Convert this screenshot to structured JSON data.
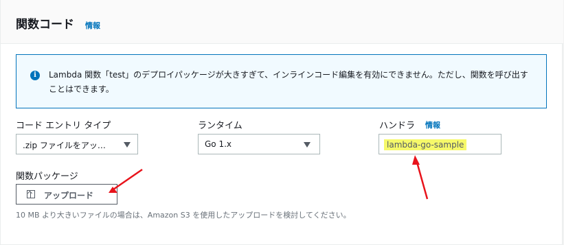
{
  "header": {
    "title": "関数コード",
    "info": "情報"
  },
  "alert": {
    "icon": "info-icon",
    "text": "Lambda 関数「test」のデプロイパッケージが大きすぎて、インラインコード編集を有効にできません。ただし、関数を呼び出すことはできます。"
  },
  "fields": {
    "entry_type": {
      "label": "コード エントリ タイプ",
      "value": ".zip ファイルをアッ…"
    },
    "runtime": {
      "label": "ランタイム",
      "value": "Go 1.x"
    },
    "handler": {
      "label": "ハンドラ",
      "info": "情報",
      "value": "lambda-go-sample"
    }
  },
  "package": {
    "label": "関数パッケージ",
    "upload_button": "アップロード",
    "hint": "10 MB より大きいファイルの場合は、Amazon S3 を使用したアップロードを検討してください。"
  },
  "colors": {
    "annotation_arrow": "#e8131b",
    "highlight": "#f6f96a",
    "link": "#0073bb"
  }
}
